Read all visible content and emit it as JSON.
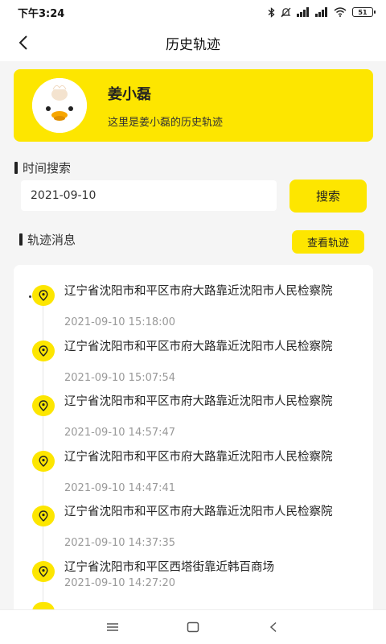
{
  "status_bar": {
    "time": "下午3:24",
    "battery": "51"
  },
  "header": {
    "title": "历史轨迹"
  },
  "profile": {
    "name": "姜小磊",
    "description": "这里是姜小磊的历史轨迹"
  },
  "time_search": {
    "label": "时间搜索",
    "date_value": "2021-09-10",
    "search_button": "搜索"
  },
  "track_section": {
    "label": "轨迹消息",
    "view_button": "查看轨迹"
  },
  "tracks": [
    {
      "address": "辽宁省沈阳市和平区市府大路靠近沈阳市人民检察院",
      "time": "2021-09-10 15:18:00"
    },
    {
      "address": "辽宁省沈阳市和平区市府大路靠近沈阳市人民检察院",
      "time": "2021-09-10 15:07:54"
    },
    {
      "address": "辽宁省沈阳市和平区市府大路靠近沈阳市人民检察院",
      "time": "2021-09-10 14:57:47"
    },
    {
      "address": "辽宁省沈阳市和平区市府大路靠近沈阳市人民检察院",
      "time": "2021-09-10 14:47:41"
    },
    {
      "address": "辽宁省沈阳市和平区市府大路靠近沈阳市人民检察院",
      "time": "2021-09-10 14:37:35"
    },
    {
      "address": "辽宁省沈阳市和平区西塔街靠近韩百商场",
      "time": "2021-09-10 14:27:20"
    }
  ],
  "colors": {
    "accent": "#fde600",
    "background": "#f5f5f5",
    "muted_text": "#999999"
  },
  "icons": [
    "back-arrow-icon",
    "location-pin-icon",
    "bluetooth-icon",
    "wifi-icon",
    "signal-icon",
    "menu-icon",
    "home-icon",
    "back-nav-icon",
    "duck-avatar"
  ]
}
